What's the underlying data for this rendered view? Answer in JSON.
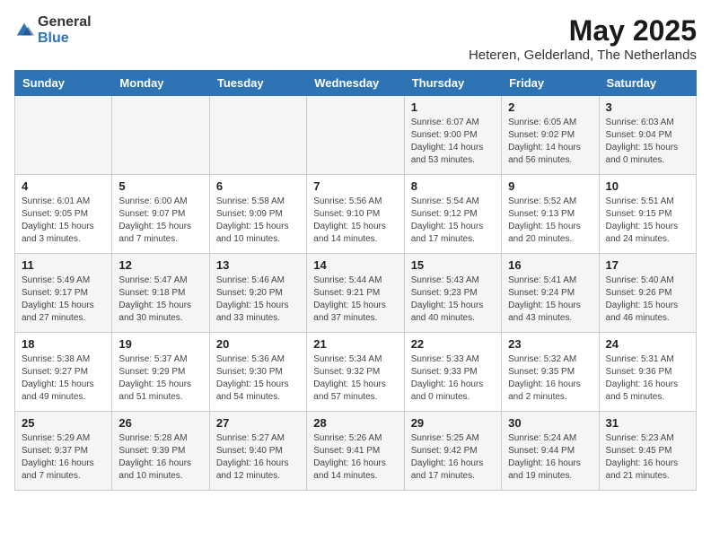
{
  "header": {
    "logo_general": "General",
    "logo_blue": "Blue",
    "title": "May 2025",
    "subtitle": "Heteren, Gelderland, The Netherlands"
  },
  "columns": [
    "Sunday",
    "Monday",
    "Tuesday",
    "Wednesday",
    "Thursday",
    "Friday",
    "Saturday"
  ],
  "weeks": [
    [
      {
        "day": "",
        "content": ""
      },
      {
        "day": "",
        "content": ""
      },
      {
        "day": "",
        "content": ""
      },
      {
        "day": "",
        "content": ""
      },
      {
        "day": "1",
        "content": "Sunrise: 6:07 AM\nSunset: 9:00 PM\nDaylight: 14 hours\nand 53 minutes."
      },
      {
        "day": "2",
        "content": "Sunrise: 6:05 AM\nSunset: 9:02 PM\nDaylight: 14 hours\nand 56 minutes."
      },
      {
        "day": "3",
        "content": "Sunrise: 6:03 AM\nSunset: 9:04 PM\nDaylight: 15 hours\nand 0 minutes."
      }
    ],
    [
      {
        "day": "4",
        "content": "Sunrise: 6:01 AM\nSunset: 9:05 PM\nDaylight: 15 hours\nand 3 minutes."
      },
      {
        "day": "5",
        "content": "Sunrise: 6:00 AM\nSunset: 9:07 PM\nDaylight: 15 hours\nand 7 minutes."
      },
      {
        "day": "6",
        "content": "Sunrise: 5:58 AM\nSunset: 9:09 PM\nDaylight: 15 hours\nand 10 minutes."
      },
      {
        "day": "7",
        "content": "Sunrise: 5:56 AM\nSunset: 9:10 PM\nDaylight: 15 hours\nand 14 minutes."
      },
      {
        "day": "8",
        "content": "Sunrise: 5:54 AM\nSunset: 9:12 PM\nDaylight: 15 hours\nand 17 minutes."
      },
      {
        "day": "9",
        "content": "Sunrise: 5:52 AM\nSunset: 9:13 PM\nDaylight: 15 hours\nand 20 minutes."
      },
      {
        "day": "10",
        "content": "Sunrise: 5:51 AM\nSunset: 9:15 PM\nDaylight: 15 hours\nand 24 minutes."
      }
    ],
    [
      {
        "day": "11",
        "content": "Sunrise: 5:49 AM\nSunset: 9:17 PM\nDaylight: 15 hours\nand 27 minutes."
      },
      {
        "day": "12",
        "content": "Sunrise: 5:47 AM\nSunset: 9:18 PM\nDaylight: 15 hours\nand 30 minutes."
      },
      {
        "day": "13",
        "content": "Sunrise: 5:46 AM\nSunset: 9:20 PM\nDaylight: 15 hours\nand 33 minutes."
      },
      {
        "day": "14",
        "content": "Sunrise: 5:44 AM\nSunset: 9:21 PM\nDaylight: 15 hours\nand 37 minutes."
      },
      {
        "day": "15",
        "content": "Sunrise: 5:43 AM\nSunset: 9:23 PM\nDaylight: 15 hours\nand 40 minutes."
      },
      {
        "day": "16",
        "content": "Sunrise: 5:41 AM\nSunset: 9:24 PM\nDaylight: 15 hours\nand 43 minutes."
      },
      {
        "day": "17",
        "content": "Sunrise: 5:40 AM\nSunset: 9:26 PM\nDaylight: 15 hours\nand 46 minutes."
      }
    ],
    [
      {
        "day": "18",
        "content": "Sunrise: 5:38 AM\nSunset: 9:27 PM\nDaylight: 15 hours\nand 49 minutes."
      },
      {
        "day": "19",
        "content": "Sunrise: 5:37 AM\nSunset: 9:29 PM\nDaylight: 15 hours\nand 51 minutes."
      },
      {
        "day": "20",
        "content": "Sunrise: 5:36 AM\nSunset: 9:30 PM\nDaylight: 15 hours\nand 54 minutes."
      },
      {
        "day": "21",
        "content": "Sunrise: 5:34 AM\nSunset: 9:32 PM\nDaylight: 15 hours\nand 57 minutes."
      },
      {
        "day": "22",
        "content": "Sunrise: 5:33 AM\nSunset: 9:33 PM\nDaylight: 16 hours\nand 0 minutes."
      },
      {
        "day": "23",
        "content": "Sunrise: 5:32 AM\nSunset: 9:35 PM\nDaylight: 16 hours\nand 2 minutes."
      },
      {
        "day": "24",
        "content": "Sunrise: 5:31 AM\nSunset: 9:36 PM\nDaylight: 16 hours\nand 5 minutes."
      }
    ],
    [
      {
        "day": "25",
        "content": "Sunrise: 5:29 AM\nSunset: 9:37 PM\nDaylight: 16 hours\nand 7 minutes."
      },
      {
        "day": "26",
        "content": "Sunrise: 5:28 AM\nSunset: 9:39 PM\nDaylight: 16 hours\nand 10 minutes."
      },
      {
        "day": "27",
        "content": "Sunrise: 5:27 AM\nSunset: 9:40 PM\nDaylight: 16 hours\nand 12 minutes."
      },
      {
        "day": "28",
        "content": "Sunrise: 5:26 AM\nSunset: 9:41 PM\nDaylight: 16 hours\nand 14 minutes."
      },
      {
        "day": "29",
        "content": "Sunrise: 5:25 AM\nSunset: 9:42 PM\nDaylight: 16 hours\nand 17 minutes."
      },
      {
        "day": "30",
        "content": "Sunrise: 5:24 AM\nSunset: 9:44 PM\nDaylight: 16 hours\nand 19 minutes."
      },
      {
        "day": "31",
        "content": "Sunrise: 5:23 AM\nSunset: 9:45 PM\nDaylight: 16 hours\nand 21 minutes."
      }
    ]
  ]
}
